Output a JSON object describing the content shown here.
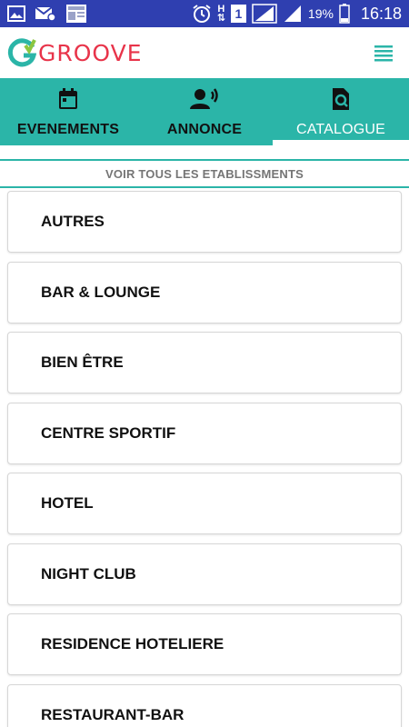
{
  "status_bar": {
    "sim_label": "H",
    "sim_slot": "1",
    "battery_percent": "19%",
    "time": "16:18",
    "icons": [
      "image-icon",
      "mail-icon",
      "news-icon",
      "alarm-icon",
      "sim-icon",
      "signal-icon",
      "signal-icon",
      "battery-icon"
    ]
  },
  "header": {
    "logo_text": "GROOVE",
    "menu_icon": "menu-icon"
  },
  "tabs": [
    {
      "label": "EVENEMENTS",
      "icon": "calendar-icon",
      "active": false
    },
    {
      "label": "ANNONCE",
      "icon": "announce-icon",
      "active": false
    },
    {
      "label": "CATALOGUE",
      "icon": "catalogue-search-icon",
      "active": true
    }
  ],
  "section": {
    "title": "VOIR TOUS LES ETABLISSMENTS"
  },
  "categories": [
    "AUTRES",
    "BAR & LOUNGE",
    "BIEN ÊTRE",
    "CENTRE SPORTIF",
    "HOTEL",
    "NIGHT CLUB",
    "RESIDENCE HOTELIERE",
    "RESTAURANT-BAR"
  ],
  "colors": {
    "status_bar": "#2f3fb0",
    "accent": "#2bb5a8",
    "logo_red": "#e8344a",
    "logo_green": "#8cc63f"
  }
}
